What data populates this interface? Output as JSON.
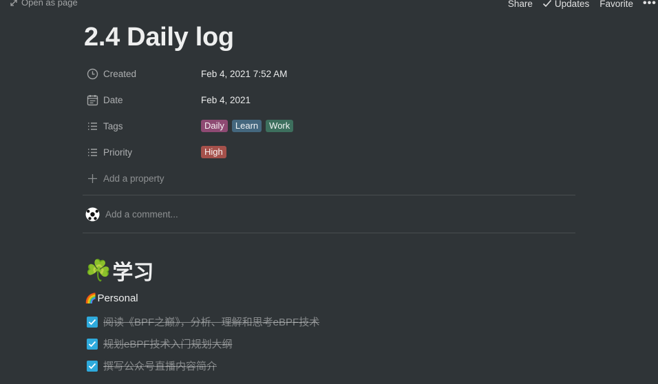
{
  "topbar": {
    "open_as_page": "Open as page",
    "share": "Share",
    "updates": "Updates",
    "favorite": "Favorite",
    "more": "•••"
  },
  "page": {
    "title": "2.4 Daily log"
  },
  "properties": {
    "created": {
      "label": "Created",
      "value": "Feb 4, 2021 7:52 AM",
      "icon": "clock-icon"
    },
    "date": {
      "label": "Date",
      "value": "Feb 4, 2021",
      "icon": "calendar-icon"
    },
    "tags": {
      "label": "Tags",
      "icon": "list-icon",
      "values": [
        {
          "text": "Daily",
          "color": "#8e4a73"
        },
        {
          "text": "Learn",
          "color": "#44677e"
        },
        {
          "text": "Work",
          "color": "#3d6f5d"
        }
      ]
    },
    "priority": {
      "label": "Priority",
      "icon": "list-icon",
      "values": [
        {
          "text": "High",
          "color": "#a5514b"
        }
      ]
    },
    "add_property": "Add a property"
  },
  "comment": {
    "placeholder": "Add a comment..."
  },
  "content": {
    "heading_emoji": "☘️",
    "heading": "学习",
    "subheading_emoji": "🌈",
    "subheading": "Personal",
    "todos": [
      {
        "text": "阅读《BPF之巅》，分析、理解和思考eBPF技术",
        "checked": true
      },
      {
        "text": "规划eBPF技术入门规划大纲",
        "checked": true
      },
      {
        "text": "撰写公众号直播内容简介",
        "checked": true
      }
    ],
    "accent_color": "#2eaadc"
  }
}
